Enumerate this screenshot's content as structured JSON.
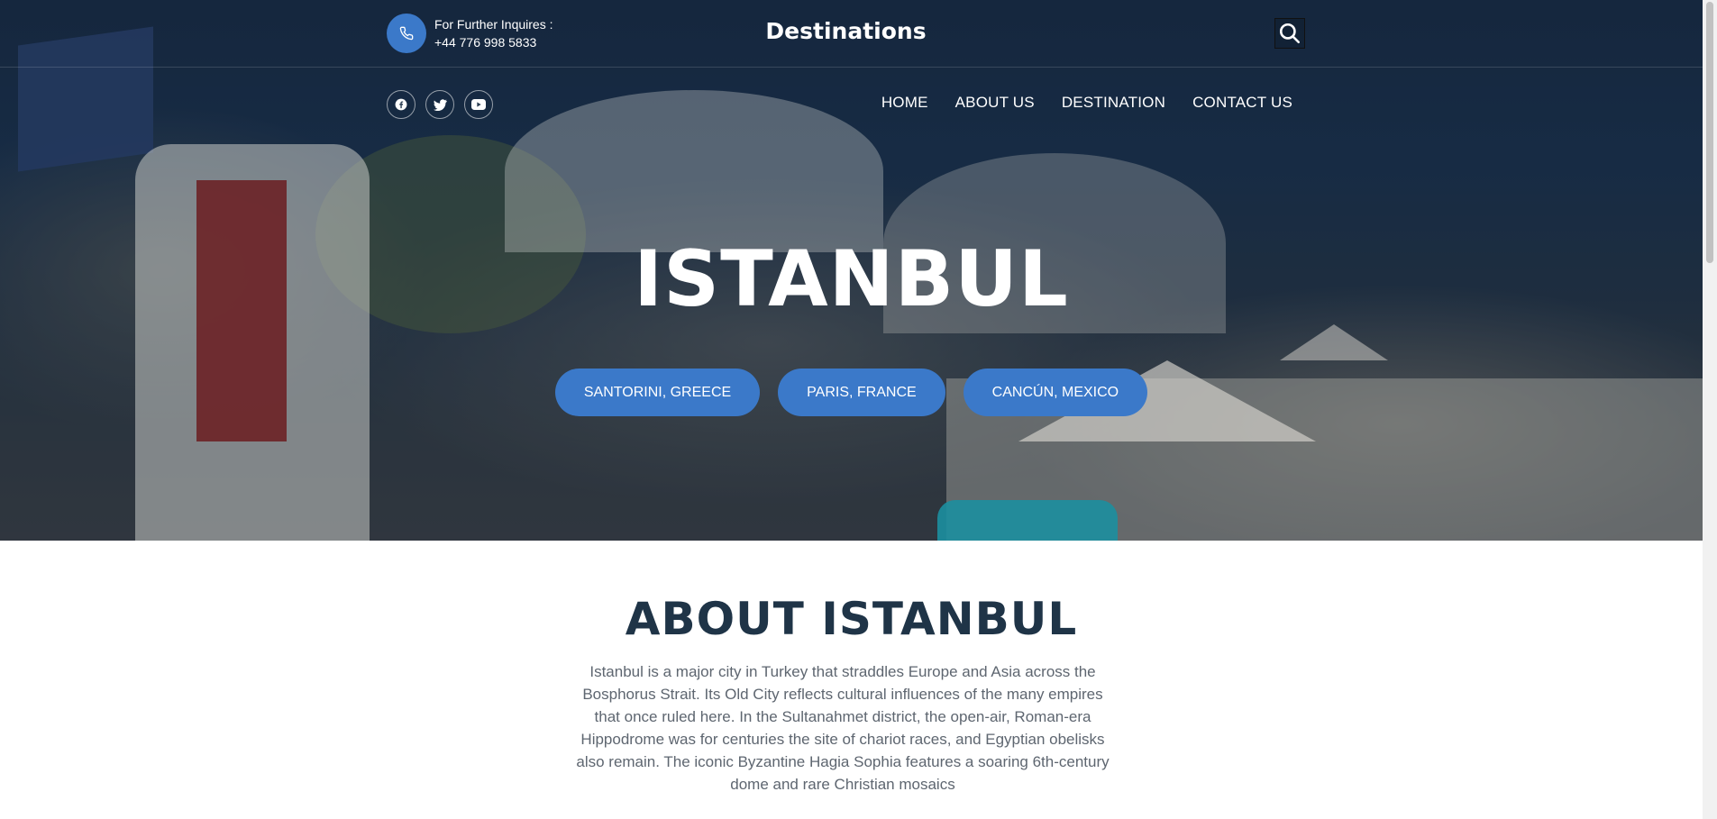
{
  "header": {
    "inquiry_label": "For Further Inquires :",
    "phone": "+44 776 998 5833",
    "brand": "Destinations"
  },
  "icons": {
    "phone": "phone-icon",
    "search": "search-icon",
    "facebook": "facebook-icon",
    "twitter": "twitter-icon",
    "youtube": "youtube-icon"
  },
  "nav": {
    "items": [
      "HOME",
      "ABOUT US",
      "DESTINATION",
      "CONTACT US"
    ]
  },
  "hero": {
    "title": "ISTANBUL",
    "buttons": [
      "SANTORINI, GREECE",
      "PARIS, FRANCE",
      "CANCÚN, MEXICO"
    ]
  },
  "about": {
    "title": "ABOUT ISTANBUL",
    "text": "Istanbul is a major city in Turkey that straddles Europe and Asia across the Bosphorus Strait. Its Old City reflects cultural influences of the many empires that once ruled here. In the Sultanahmet district, the open-air, Roman-era Hippodrome was for centuries the site of chariot races, and Egyptian obelisks also remain. The iconic Byzantine Hagia Sophia features a soaring 6th-century dome and rare Christian mosaics"
  },
  "colors": {
    "accent": "#3b79c9",
    "heading": "#1f3447",
    "body_text": "#5e6670"
  }
}
